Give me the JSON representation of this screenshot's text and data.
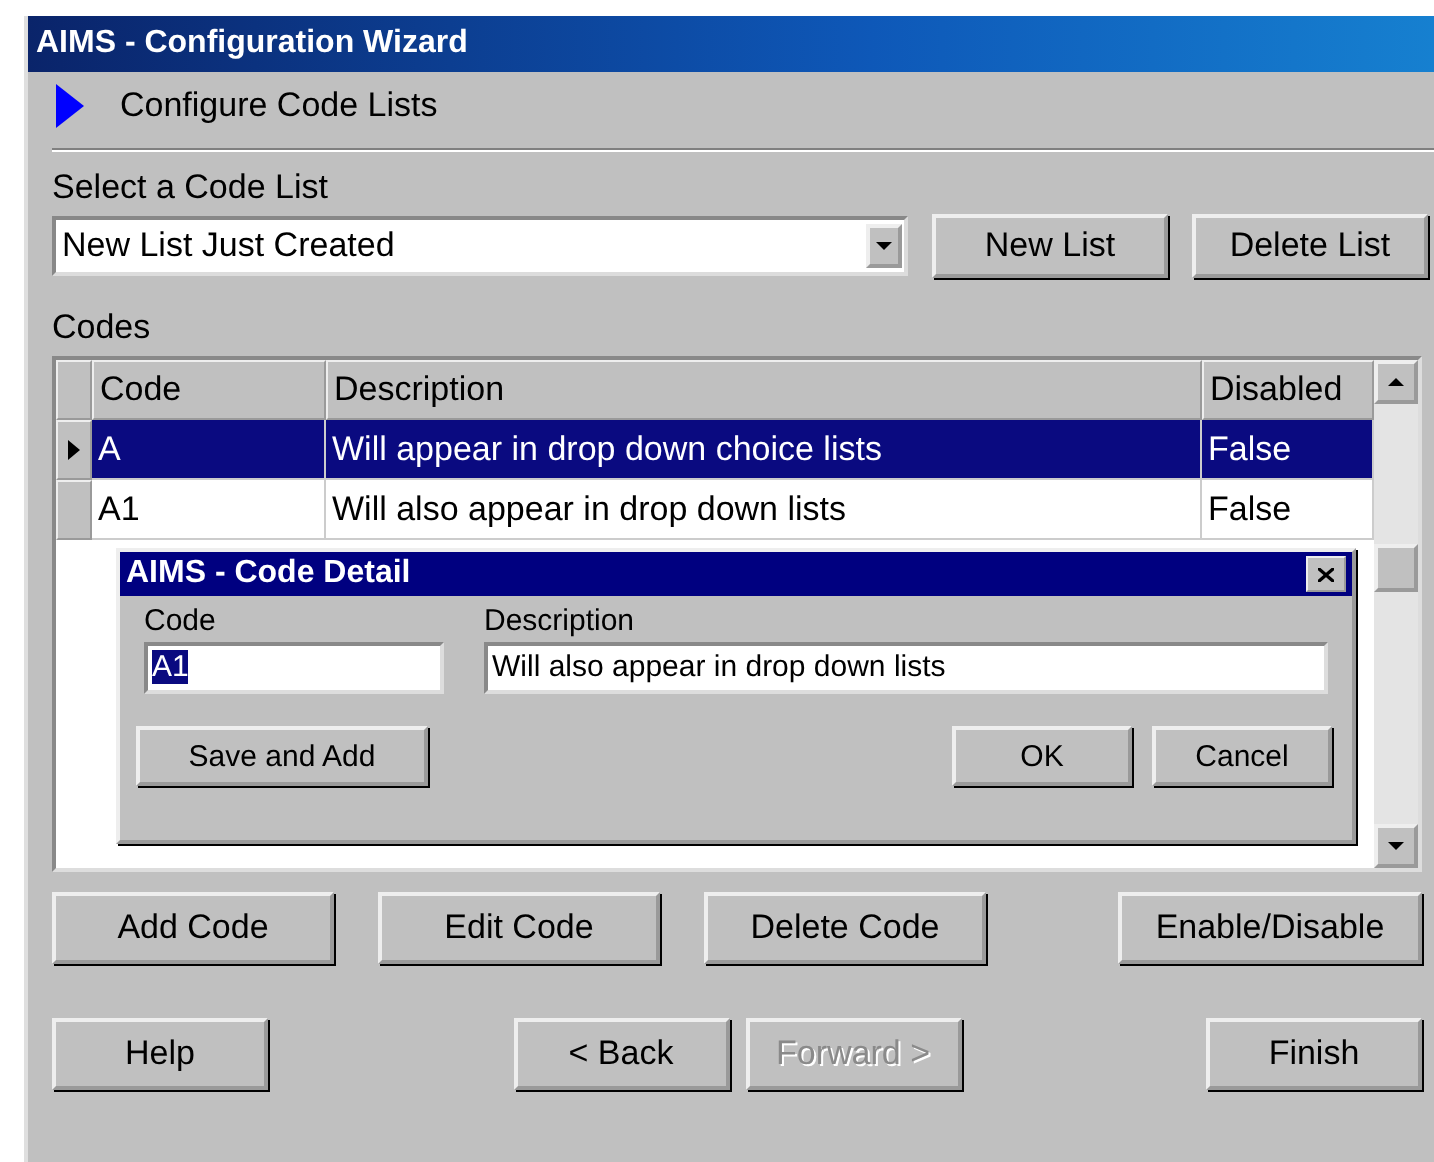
{
  "window": {
    "title": "AIMS - Configuration Wizard"
  },
  "step": {
    "title": "Configure Code Lists"
  },
  "code_list": {
    "label": "Select a Code List",
    "value": "New List Just Created",
    "buttons": [
      "New List",
      "Delete List"
    ]
  },
  "codes": {
    "label": "Codes",
    "columns": [
      "Code",
      "Description",
      "Disabled"
    ],
    "rows": [
      {
        "code": "A",
        "description": "Will appear in drop down choice lists",
        "disabled": "False",
        "selected": true
      },
      {
        "code": "A1",
        "description": "Will also appear in drop down lists",
        "disabled": "False",
        "selected": false
      }
    ]
  },
  "dialog": {
    "title": "AIMS - Code Detail",
    "code_label": "Code",
    "code_value": "A1",
    "description_label": "Description",
    "description_value": "Will also appear in drop down lists",
    "buttons": [
      {
        "label": "Save and Add",
        "kind": "left"
      },
      {
        "label": "OK",
        "kind": "right"
      },
      {
        "label": "Cancel",
        "kind": "right"
      }
    ]
  },
  "code_buttons": [
    "Add Code",
    "Edit Code",
    "Delete Code",
    "Enable/Disable"
  ],
  "nav_buttons": [
    {
      "label": "Help",
      "kind": "left",
      "disabled": false
    },
    {
      "label": "< Back",
      "kind": "middle",
      "disabled": false
    },
    {
      "label": "Forward >",
      "kind": "middle",
      "disabled": true
    },
    {
      "label": "Finish",
      "kind": "right",
      "disabled": false
    }
  ]
}
